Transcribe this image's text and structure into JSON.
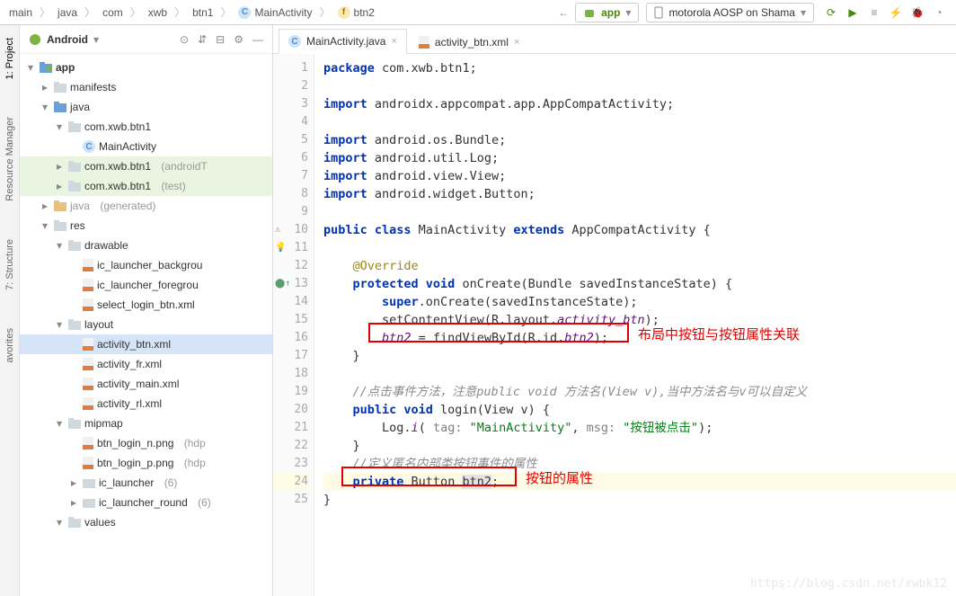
{
  "breadcrumbs": [
    "main",
    "java",
    "com",
    "xwb",
    "btn1"
  ],
  "breadcrumb_class": {
    "icon": "C",
    "name": "MainActivity"
  },
  "breadcrumb_method": {
    "icon": "f",
    "name": "btn2"
  },
  "run_config": {
    "name": "app"
  },
  "device": {
    "name": "motorola AOSP on Shama"
  },
  "panel": {
    "title": "Android"
  },
  "tree": {
    "app": "app",
    "manifests": "manifests",
    "java": "java",
    "pkg_main": "com.xwb.btn1",
    "main_activity": "MainActivity",
    "pkg_androidTest": "com.xwb.btn1",
    "pkg_androidTest_suffix": "(androidT",
    "pkg_test": "com.xwb.btn1",
    "pkg_test_suffix": "(test)",
    "java_gen": "java",
    "java_gen_suffix": "(generated)",
    "res": "res",
    "drawable": "drawable",
    "d1": "ic_launcher_backgrou",
    "d2": "ic_launcher_foregrou",
    "d3": "select_login_btn.xml",
    "layout": "layout",
    "l1": "activity_btn.xml",
    "l2": "activity_fr.xml",
    "l3": "activity_main.xml",
    "l4": "activity_rl.xml",
    "mipmap": "mipmap",
    "m1": "btn_login_n.png",
    "m1_suffix": "(hdp",
    "m2": "btn_login_p.png",
    "m2_suffix": "(hdp",
    "m3": "ic_launcher",
    "m3_suffix": "(6)",
    "m4": "ic_launcher_round",
    "m4_suffix": "(6)",
    "values": "values"
  },
  "tabs": {
    "t1": "MainActivity.java",
    "t2": "activity_btn.xml"
  },
  "code": {
    "l1": {
      "a": "package",
      "b": " com.xwb.btn1;"
    },
    "l3": {
      "a": "import",
      "b": " androidx.appcompat.app.AppCompatActivity;"
    },
    "l5": {
      "a": "import",
      "b": " android.os.Bundle;"
    },
    "l6": {
      "a": "import",
      "b": " android.util.Log;"
    },
    "l7": {
      "a": "import",
      "b": " android.view.View;"
    },
    "l8": {
      "a": "import",
      "b": " android.widget.Button;"
    },
    "l10": {
      "a": "public class",
      "b": " MainActivity ",
      "c": "extends",
      "d": " AppCompatActivity {"
    },
    "l12": {
      "a": "@Override"
    },
    "l13": {
      "a": "protected void",
      "b": " onCreate(Bundle savedInstanceState) {"
    },
    "l14": {
      "a": "super",
      "b": ".onCreate(savedInstanceState);"
    },
    "l15": {
      "a": "setContentView(R.layout.",
      "b": "activity_btn",
      "c": ");"
    },
    "l16": {
      "a": "btn2",
      "b": " = findViewById(R.id.",
      "c": "btn2",
      "d": ");"
    },
    "l17": {
      "a": "}"
    },
    "l19": {
      "a": "//点击事件方法，注意public void 方法名(View v),当中方法名与v可以自定义"
    },
    "l20": {
      "a": "public void",
      "b": " login(View v) {"
    },
    "l21": {
      "a": "Log.",
      "b": "i",
      "c": "( ",
      "d": "tag:",
      "e": " \"MainActivity\"",
      "f": ", ",
      "g": "msg:",
      "h": " \"按钮被点击\"",
      "i": ");"
    },
    "l22": {
      "a": "}"
    },
    "l23": {
      "a": "//定义匿名内部类按钮事件的属性"
    },
    "l24": {
      "a": "private",
      "b": " Button ",
      "c": "btn2",
      "d": ";"
    },
    "l25": {
      "a": "}"
    }
  },
  "annotations": {
    "a1": "布局中按钮与按钮属性关联",
    "a2": "按钮的属性"
  },
  "side_tabs": {
    "project": "1: Project",
    "resmgr": "Resource Manager",
    "structure": "7: Structure",
    "favorites": "avorites"
  },
  "watermark": "https://blog.csdn.net/xwbk12"
}
